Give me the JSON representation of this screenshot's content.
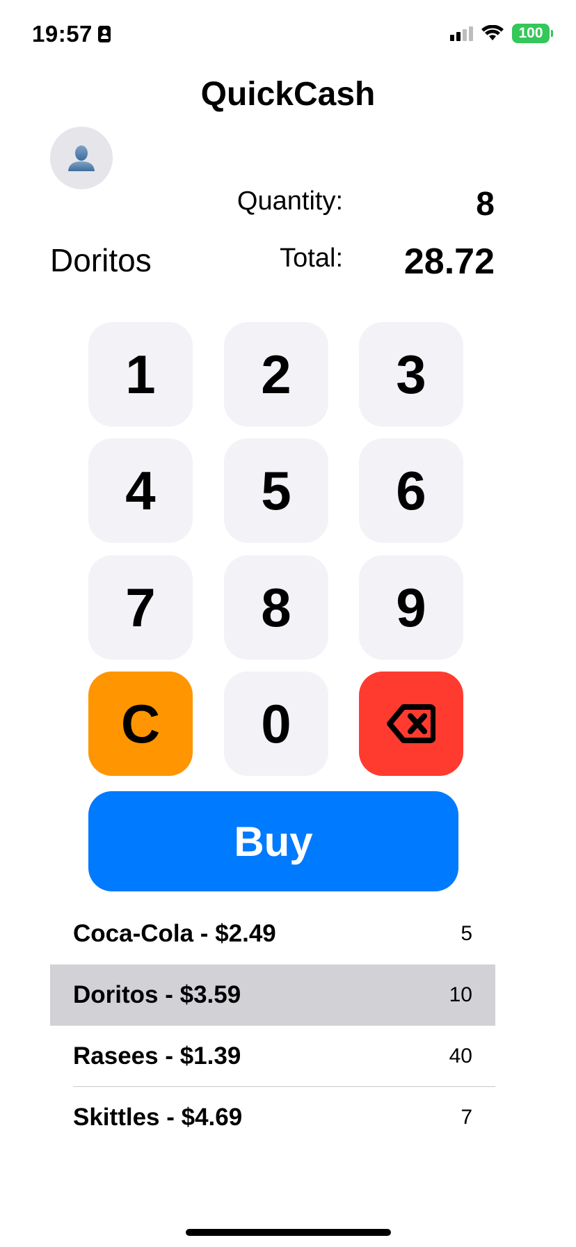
{
  "status_bar": {
    "time": "19:57",
    "battery": "100",
    "icons": [
      "id-card-icon",
      "signal-icon",
      "wifi-icon",
      "battery-icon"
    ]
  },
  "app": {
    "title": "QuickCash"
  },
  "summary": {
    "product_name": "Doritos",
    "quantity_label": "Quantity:",
    "quantity_value": "8",
    "total_label": "Total:",
    "total_value": "28.72"
  },
  "keypad": {
    "keys": [
      "1",
      "2",
      "3",
      "4",
      "5",
      "6",
      "7",
      "8",
      "9",
      "C",
      "0"
    ],
    "backspace_icon": "delete-left-icon",
    "colors": {
      "key_bg": "#f2f2f7",
      "clear_bg": "#ff9500",
      "backspace_bg": "#ff3b30"
    }
  },
  "buy_button": {
    "label": "Buy",
    "color": "#007aff"
  },
  "products": [
    {
      "name": "Coca-Cola - $2.49",
      "stock": "5",
      "selected": false
    },
    {
      "name": "Doritos - $3.59",
      "stock": "10",
      "selected": true
    },
    {
      "name": "Rasees - $1.39",
      "stock": "40",
      "selected": false
    },
    {
      "name": "Skittles - $4.69",
      "stock": "7",
      "selected": false
    }
  ]
}
